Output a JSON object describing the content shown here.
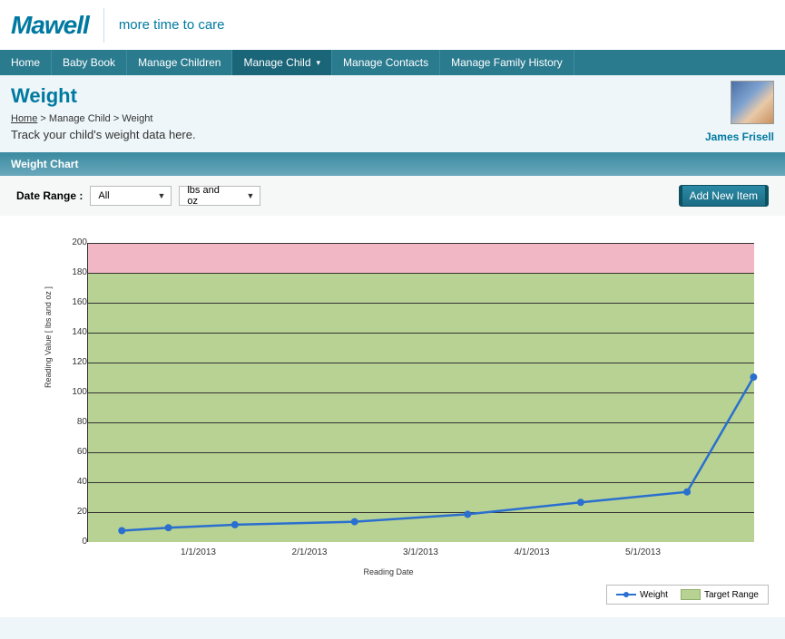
{
  "brand": {
    "logo": "Mawell",
    "tagline": "more time to care"
  },
  "nav": {
    "items": [
      {
        "label": "Home"
      },
      {
        "label": "Baby Book"
      },
      {
        "label": "Manage Children"
      },
      {
        "label": "Manage Child",
        "active": true,
        "dropdown": true
      },
      {
        "label": "Manage Contacts"
      },
      {
        "label": "Manage Family History"
      }
    ]
  },
  "page": {
    "title": "Weight",
    "breadcrumb": {
      "home": "Home",
      "sep": ">",
      "mid": "Manage Child",
      "leaf": "Weight"
    },
    "description": "Track your child's weight data here."
  },
  "profile": {
    "name": "James Frisell"
  },
  "panel": {
    "title": "Weight Chart"
  },
  "controls": {
    "label": "Date Range :",
    "range_value": "All",
    "unit_value": "lbs and oz",
    "add_button": "Add New Item"
  },
  "legend": {
    "series": "Weight",
    "band": "Target Range"
  },
  "chart_data": {
    "type": "line",
    "title": "",
    "xlabel": "Reading Date",
    "ylabel": "Reading Value [ lbs and oz ]",
    "ylim": [
      0,
      200
    ],
    "y_ticks": [
      0,
      20,
      40,
      60,
      80,
      100,
      120,
      140,
      160,
      180,
      200
    ],
    "x_ticks": [
      "1/1/2013",
      "2/1/2013",
      "3/1/2013",
      "4/1/2013",
      "5/1/2013"
    ],
    "target_range": [
      0,
      180
    ],
    "over_range": [
      180,
      200
    ],
    "series": [
      {
        "name": "Weight",
        "x": [
          0.05,
          0.12,
          0.22,
          0.4,
          0.57,
          0.74,
          0.9,
          1.0
        ],
        "values": [
          7,
          9,
          11,
          13,
          18,
          26,
          33,
          110
        ]
      }
    ]
  }
}
